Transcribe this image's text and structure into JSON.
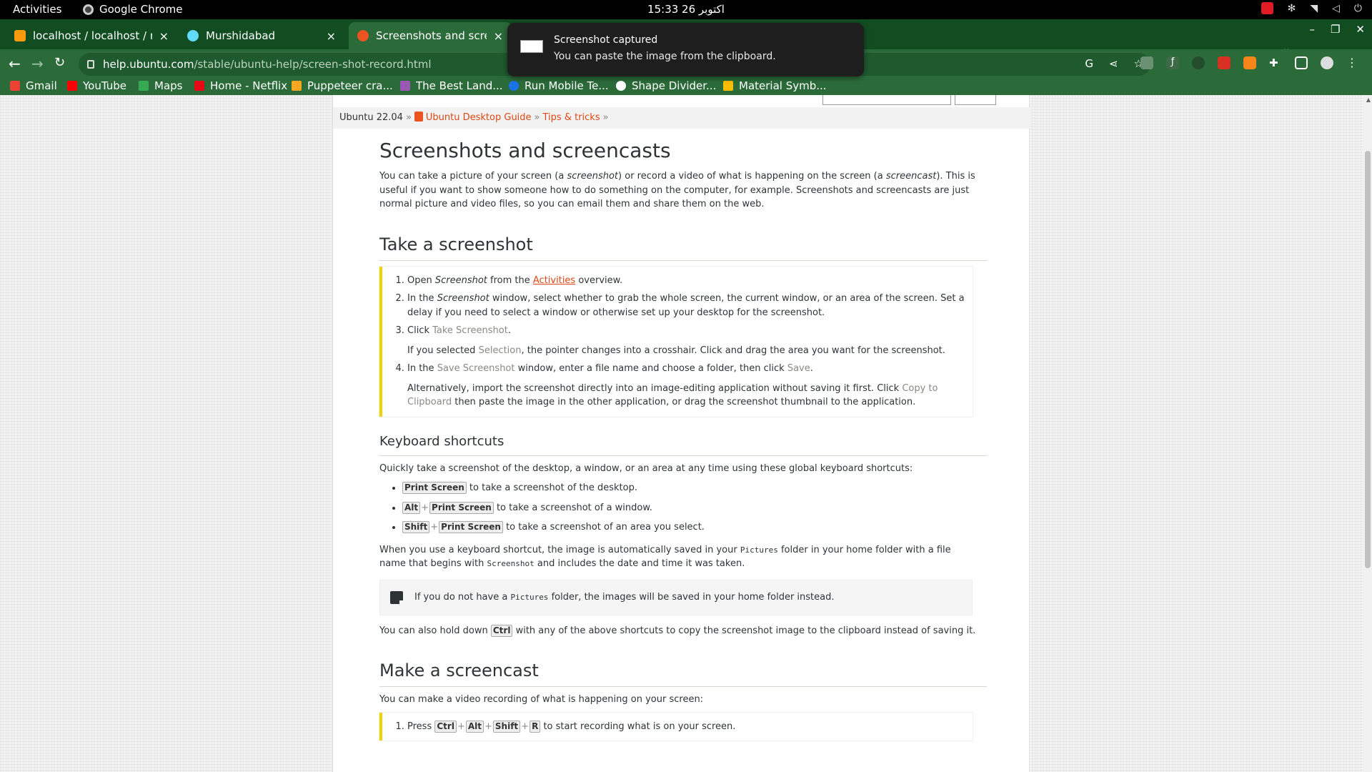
{
  "system": {
    "activities": "Activities",
    "app_name": "Google Chrome",
    "clock": "15:33  26 اکتوبر"
  },
  "tabs": [
    {
      "title": "localhost / localhost / ref",
      "favicon": "phpmyadmin-icon"
    },
    {
      "title": "Murshidabad",
      "favicon": "react-icon"
    },
    {
      "title": "Screenshots and screencasts",
      "favicon": "ubuntu-icon"
    }
  ],
  "address_bar": {
    "host": "help.ubuntu.com",
    "path": "/stable/ubuntu-help/screen-shot-record.html"
  },
  "bookmarks": [
    {
      "label": "Gmail",
      "color": "#ea4335"
    },
    {
      "label": "YouTube",
      "color": "#ff0000"
    },
    {
      "label": "Maps",
      "color": "#34a853"
    },
    {
      "label": "Home - Netflix",
      "color": "#e50914"
    },
    {
      "label": "Puppeteer cra...",
      "color": "#f5a623"
    },
    {
      "label": "The Best Land...",
      "color": "#9b59b6"
    },
    {
      "label": "Run Mobile Te...",
      "color": "#1a73e8"
    },
    {
      "label": "Shape Divider...",
      "color": "#ffffff"
    },
    {
      "label": "Material Symb...",
      "color": "#fbbc04"
    }
  ],
  "notification": {
    "title": "Screenshot captured",
    "body": "You can paste the image from the clipboard."
  },
  "breadcrumb": {
    "version": "Ubuntu 22.04",
    "guide": "Ubuntu Desktop Guide",
    "section": "Tips & tricks",
    "sep": "»"
  },
  "article": {
    "title": "Screenshots and screencasts",
    "intro_1": "You can take a picture of your screen (a ",
    "intro_em1": "screenshot",
    "intro_2": ") or record a video of what is happening on the screen (a ",
    "intro_em2": "screencast",
    "intro_3": "). This is useful if you want to show someone how to do something on the computer, for example. Screenshots and screencasts are just normal picture and video files, so you can email them and share them on the web.",
    "take": {
      "heading": "Take a screenshot",
      "s1_a": "Open ",
      "s1_em": "Screenshot",
      "s1_b": " from the ",
      "s1_link": "Activities",
      "s1_c": " overview.",
      "s2_a": "In the ",
      "s2_em": "Screenshot",
      "s2_b": " window, select whether to grab the whole screen, the current window, or an area of the screen. Set a delay if you need to select a window or otherwise set up your desktop for the screenshot.",
      "s3_a": "Click ",
      "s3_gui": "Take Screenshot",
      "s3_b": ".",
      "s3_p_a": "If you selected ",
      "s3_p_gui": "Selection",
      "s3_p_b": ", the pointer changes into a crosshair. Click and drag the area you want for the screenshot.",
      "s4_a": "In the ",
      "s4_gui1": "Save Screenshot",
      "s4_b": " window, enter a file name and choose a folder, then click ",
      "s4_gui2": "Save",
      "s4_c": ".",
      "s4_p_a": "Alternatively, import the screenshot directly into an image-editing application without saving it first. Click ",
      "s4_p_gui": "Copy to Clipboard",
      "s4_p_b": " then paste the image in the other application, or drag the screenshot thumbnail to the application."
    },
    "keys": {
      "heading": "Keyboard shortcuts",
      "intro": "Quickly take a screenshot of the desktop, a window, or an area at any time using these global keyboard shortcuts:",
      "k_print": "Print Screen",
      "k_alt": "Alt",
      "k_shift": "Shift",
      "k_ctrl": "Ctrl",
      "plus": "+",
      "b1": " to take a screenshot of the desktop.",
      "b2": " to take a screenshot of a window.",
      "b3": " to take a screenshot of an area you select.",
      "p1_a": "When you use a keyboard shortcut, the image is automatically saved in your ",
      "p1_code1": "Pictures",
      "p1_b": " folder in your home folder with a file name that begins with ",
      "p1_code2": "Screenshot",
      "p1_c": " and includes the date and time it was taken.",
      "note_a": "If you do not have a ",
      "note_code": "Pictures",
      "note_b": " folder, the images will be saved in your home folder instead.",
      "p2_a": "You can also hold down ",
      "p2_b": " with any of the above shortcuts to copy the screenshot image to the clipboard instead of saving it."
    },
    "cast": {
      "heading": "Make a screencast",
      "intro": "You can make a video recording of what is happening on your screen:",
      "s1_a": "Press ",
      "k_r": "R",
      "s1_b": " to start recording what is on your screen."
    }
  }
}
